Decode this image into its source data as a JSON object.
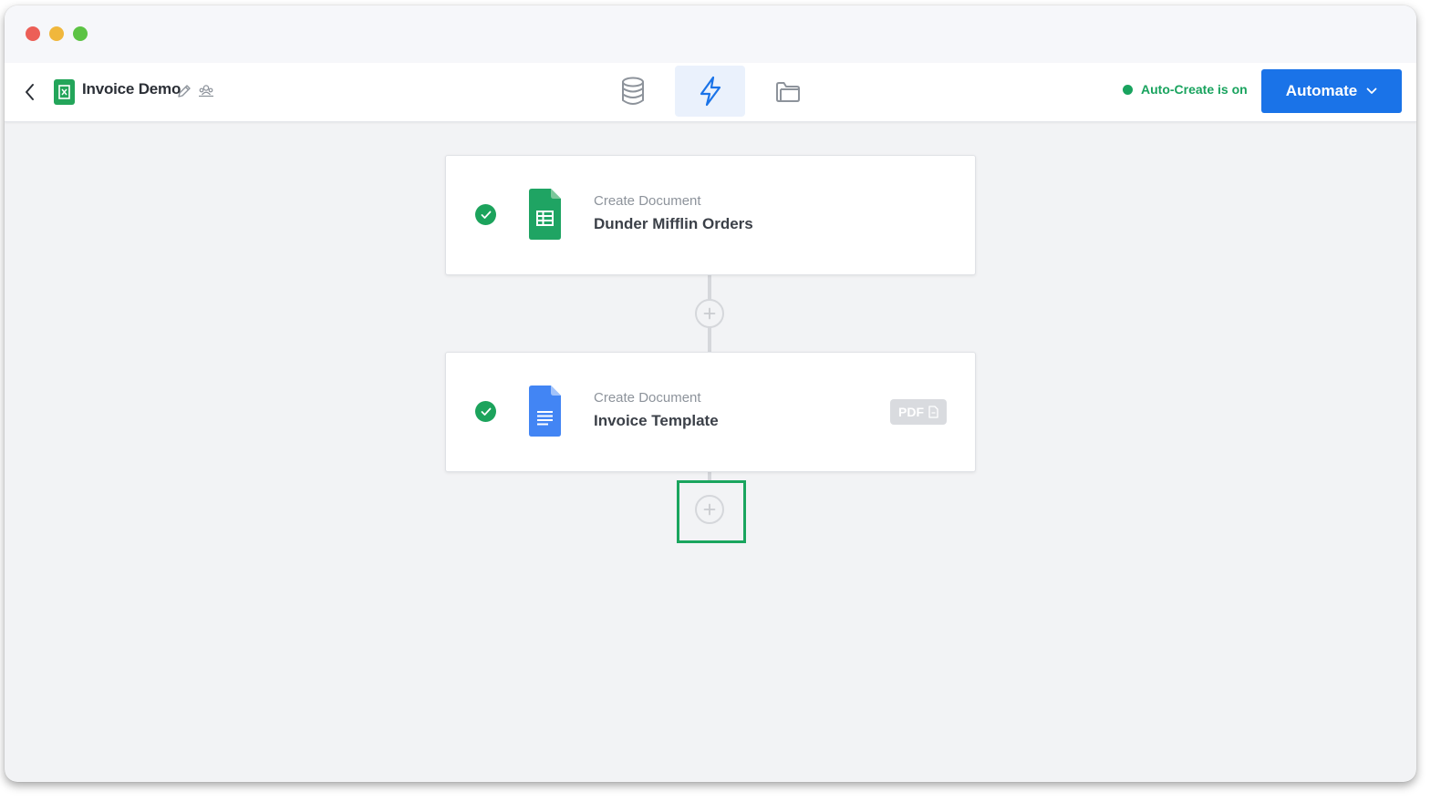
{
  "window": {
    "controls": [
      "close",
      "minimize",
      "zoom"
    ]
  },
  "header": {
    "back_icon": "chevron-left-icon",
    "doc_icon": "green-document-icon",
    "title": "Invoice Demo",
    "edit_icon": "pencil-icon",
    "share_icon": "people-icon",
    "tabs": [
      {
        "name": "data",
        "icon": "database-icon",
        "active": false
      },
      {
        "name": "automation",
        "icon": "lightning-icon",
        "active": true
      },
      {
        "name": "files",
        "icon": "folder-icon",
        "active": false
      }
    ],
    "status_text": "Auto-Create is on",
    "status_color": "#19a35e",
    "automate_label": "Automate",
    "accent_color": "#1a73e8"
  },
  "workflow": {
    "steps": [
      {
        "action": "Create Document",
        "name": "Dunder Mifflin Orders",
        "source_icon": "google-sheets-icon",
        "status": "complete",
        "output_badge": ""
      },
      {
        "action": "Create Document",
        "name": "Invoice Template",
        "source_icon": "google-docs-icon",
        "status": "complete",
        "output_badge": "PDF"
      }
    ]
  }
}
